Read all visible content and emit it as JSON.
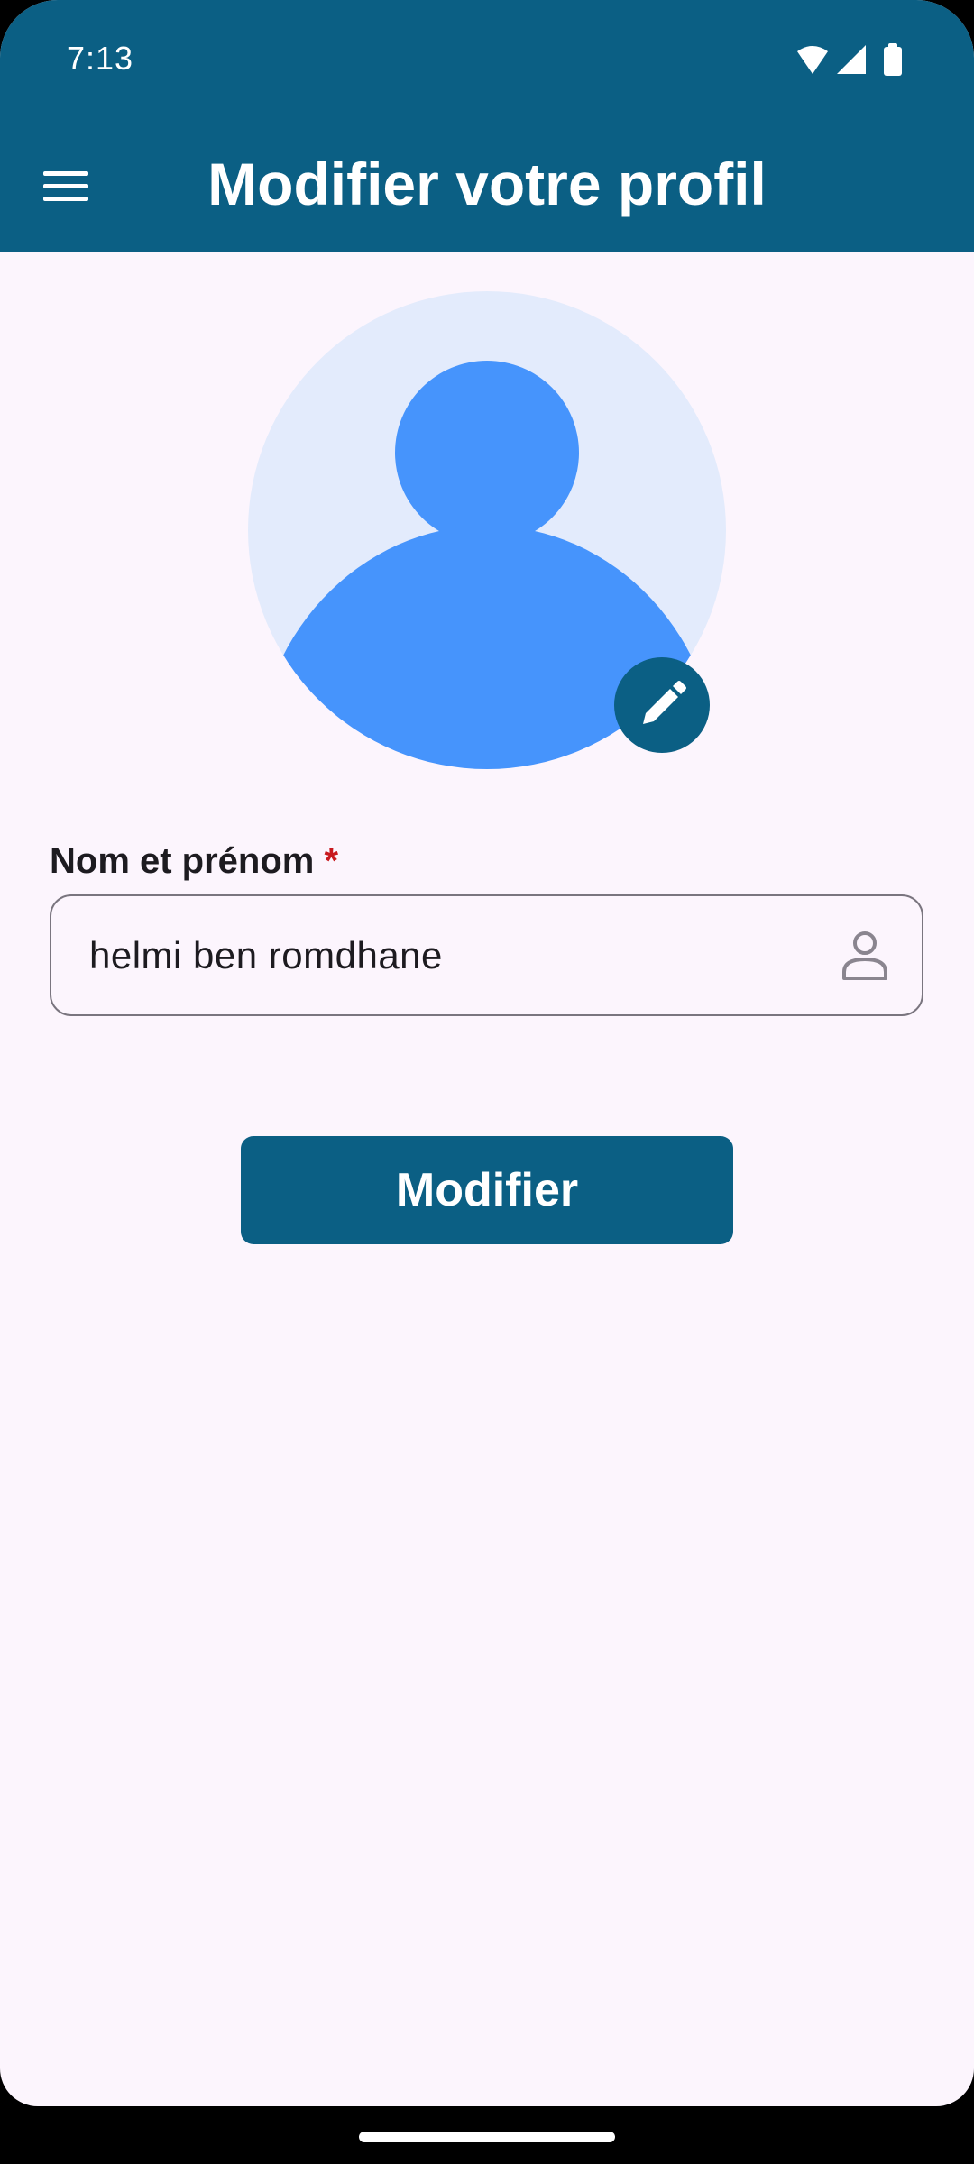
{
  "status_bar": {
    "time": "7:13",
    "icons": [
      "wifi-icon",
      "signal-icon",
      "battery-icon"
    ]
  },
  "app_bar": {
    "menu_icon": "hamburger-menu-icon",
    "title": "Modifier votre profil"
  },
  "profile": {
    "avatar_icon": "default-avatar-icon",
    "edit_icon": "pencil-icon"
  },
  "form": {
    "name_field": {
      "label": "Nom et prénom",
      "required_marker": "*",
      "value": "helmi ben romdhane",
      "trailing_icon": "person-icon"
    },
    "submit_label": "Modifier"
  },
  "colors": {
    "primary": "#0B5F84",
    "background": "#FCF5FD",
    "avatar_background": "#E3EBFC",
    "avatar_foreground": "#4694FC",
    "required": "#C8191E"
  }
}
